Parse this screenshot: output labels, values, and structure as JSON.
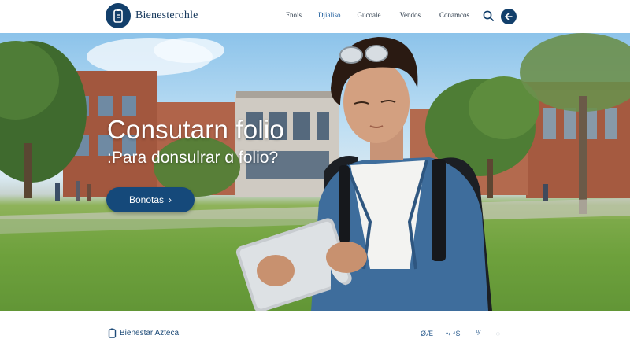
{
  "header": {
    "logo_text": "Bienesterohle",
    "nav": [
      {
        "label": "Fnois"
      },
      {
        "label": "Djialiso",
        "active": true
      },
      {
        "label": "Gucoale"
      },
      {
        "label": "Vendos"
      },
      {
        "label": "Conamcos"
      }
    ],
    "search_icon": "search-icon",
    "round_button_icon": "arrow-left-icon"
  },
  "hero": {
    "title": "Consutarn folio",
    "subtitle": ":Para donsulrar ɑ folio?",
    "cta_label": "Bonotas",
    "cta_chevron": "›"
  },
  "footer": {
    "brand_text": "Bienestar Azteca",
    "icons": [
      {
        "name": "social-icon-1",
        "glyph": "ØÆ"
      },
      {
        "name": "social-icon-2",
        "glyph": "•‹ ⁴S"
      },
      {
        "name": "social-icon-3",
        "glyph": "⁰⁄"
      },
      {
        "name": "social-icon-4",
        "glyph": "◌"
      }
    ]
  },
  "colors": {
    "brand_navy": "#123f6b",
    "cta_blue": "#15497a",
    "link_blue": "#1a5a9a",
    "text_dark": "#2b3a4a"
  }
}
